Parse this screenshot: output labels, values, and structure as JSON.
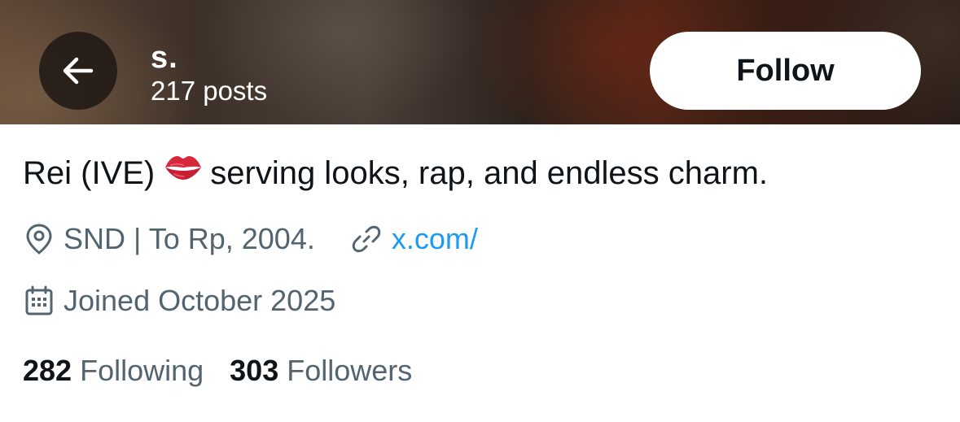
{
  "header": {
    "name": "s.",
    "posts": "217 posts",
    "follow_label": "Follow",
    "back_icon": "arrow-left-icon"
  },
  "bio": {
    "prefix": "Rei (IVE)",
    "emoji_icon": "kiss-mark-icon",
    "text": "serving looks, rap, and endless charm."
  },
  "meta": {
    "location_icon": "location-pin-icon",
    "location": "SND | To Rp, 2004.",
    "link_icon": "link-icon",
    "link": "x.com/",
    "joined_icon": "calendar-icon",
    "joined": "Joined October 2025"
  },
  "stats": {
    "following_count": "282",
    "following_label": "Following",
    "followers_count": "303",
    "followers_label": "Followers"
  },
  "colors": {
    "link": "#1d9bf0",
    "secondary_text": "#536471",
    "primary_text": "#0f1419"
  }
}
